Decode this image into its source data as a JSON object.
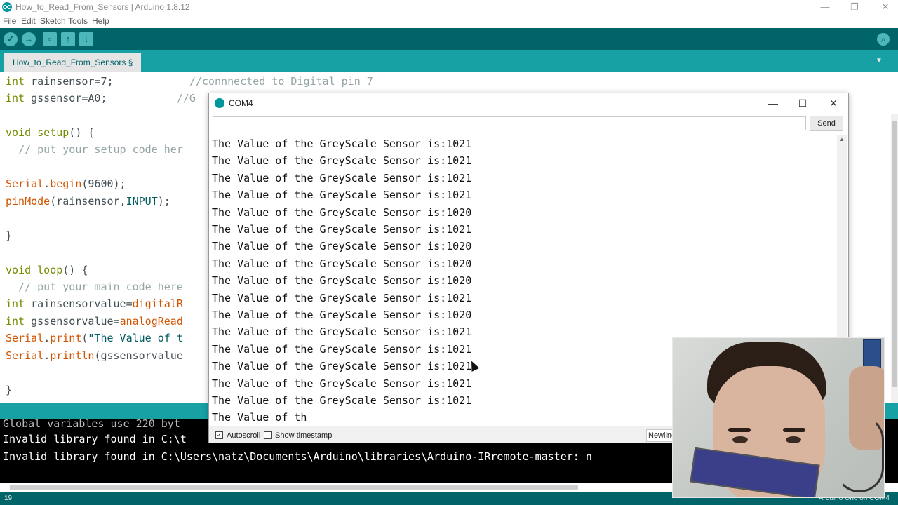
{
  "window": {
    "title": "How_to_Read_From_Sensors | Arduino 1.8.12",
    "minimize": "—",
    "restore": "❐",
    "close": "✕"
  },
  "menu": [
    "File",
    "Edit",
    "Sketch",
    "Tools",
    "Help"
  ],
  "toolbar": {
    "verify_icon": "check-icon",
    "upload_icon": "arrow-right-icon",
    "new_icon": "new-file-icon",
    "open_icon": "arrow-up-icon",
    "save_icon": "arrow-down-icon",
    "serial_monitor_icon": "magnifier-icon"
  },
  "tab": {
    "name": "How_to_Read_From_Sensors §"
  },
  "code_visible": [
    "int rainsensor=7;            //connnected to Digital pin 7",
    "int gssensor=A0;           //G",
    "",
    "void setup() {",
    "  // put your setup code her",
    "",
    "Serial.begin(9600);",
    "pinMode(rainsensor,INPUT);",
    "",
    "}",
    "",
    "void loop() {",
    "  // put your main code here",
    "int rainsensorvalue=digitalR",
    "int gssensorvalue=analogRead",
    "Serial.print(\"The Value of t",
    "Serial.println(gssensorvalue",
    "",
    "}"
  ],
  "console": {
    "lines": [
      "Global variables use 220 byt",
      "Invalid library found in C:\\t",
      "Invalid library found in C:\\Users\\natz\\Documents\\Arduino\\libraries\\Arduino-IRremote-master: n"
    ]
  },
  "status": {
    "line_number": "19",
    "board": "Arduino Uno on COM4"
  },
  "serial_monitor": {
    "title": "COM4",
    "input_value": "",
    "send_label": "Send",
    "lines": [
      "The Value of the GreyScale Sensor is:1021",
      "The Value of the GreyScale Sensor is:1021",
      "The Value of the GreyScale Sensor is:1021",
      "The Value of the GreyScale Sensor is:1021",
      "The Value of the GreyScale Sensor is:1020",
      "The Value of the GreyScale Sensor is:1021",
      "The Value of the GreyScale Sensor is:1020",
      "The Value of the GreyScale Sensor is:1020",
      "The Value of the GreyScale Sensor is:1020",
      "The Value of the GreyScale Sensor is:1021",
      "The Value of the GreyScale Sensor is:1020",
      "The Value of the GreyScale Sensor is:1021",
      "The Value of the GreyScale Sensor is:1021",
      "The Value of the GreyScale Sensor is:1021",
      "The Value of the GreyScale Sensor is:1021",
      "The Value of the GreyScale Sensor is:1021",
      "The Value of th"
    ],
    "autoscroll_label": "Autoscroll",
    "autoscroll_checked": true,
    "show_timestamp_label": "Show timestamp",
    "show_timestamp_checked": false,
    "line_ending": "Newline"
  },
  "colors": {
    "toolbar": "#006468",
    "tabbar": "#17a1a5",
    "console_bg": "#000000"
  }
}
